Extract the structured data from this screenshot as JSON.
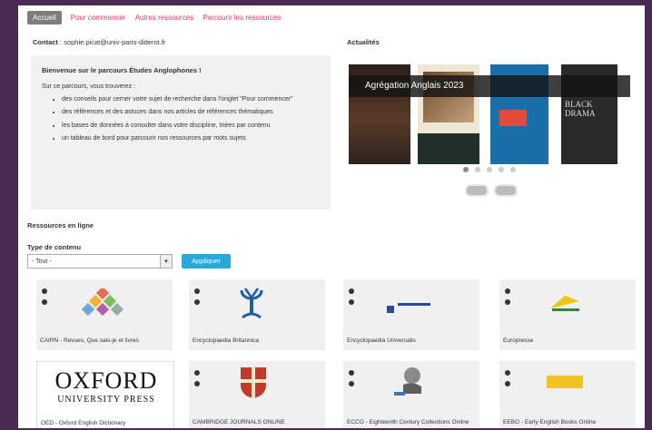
{
  "tabs": [
    {
      "label": "Accueil"
    },
    {
      "label": "Pour commencer"
    },
    {
      "label": "Autres ressources"
    },
    {
      "label": "Parcourir les ressources"
    }
  ],
  "contact": {
    "label": "Contact",
    "email": ": sophie.picat@univ-paris-diderot.fr"
  },
  "welcome": {
    "title": "Bienvenue sur le parcours Études Anglophones !",
    "intro": "Sur ce parcours, vous trouverez :",
    "items": [
      "des conseils pour cerner votre sujet de recherche dans l'onglet \"Pour commencer\"",
      "des références et des astuces dans nos articles de références thématiques",
      "les bases de données à consulter dans votre discipline, triées par contenu",
      "un tableau de bord pour parcourir nos ressources par mots sujets"
    ]
  },
  "actualites": {
    "title": "Actualités",
    "banner": "Agrégation Anglais 2023",
    "cover4": "BLACK DRAMA"
  },
  "resources_label": "Ressources en ligne",
  "filter": {
    "type_label": "Type de contenu",
    "select_value": "- Tout -",
    "apply_label": "Appliquer"
  },
  "cards": [
    {
      "label": "CAIRN - Revues, Que sais-je et livres"
    },
    {
      "label": "Encyclopaedia Britannica"
    },
    {
      "label": "Encyclopaedia Universalis"
    },
    {
      "label": "Europresse"
    },
    {
      "label": "OED - Oxford English Dictionary",
      "logo_line1": "OXFORD",
      "logo_line2": "UNIVERSITY PRESS"
    },
    {
      "label": "CAMBRIDGE JOURNALS ONLINE"
    },
    {
      "label": "ECCO - Eighteenth Century Collections Online"
    },
    {
      "label": "EEBO - Early English Books Online"
    }
  ],
  "colors": {
    "accent": "#e0356c",
    "button": "#29a8d8",
    "frame": "#4a2a52"
  }
}
